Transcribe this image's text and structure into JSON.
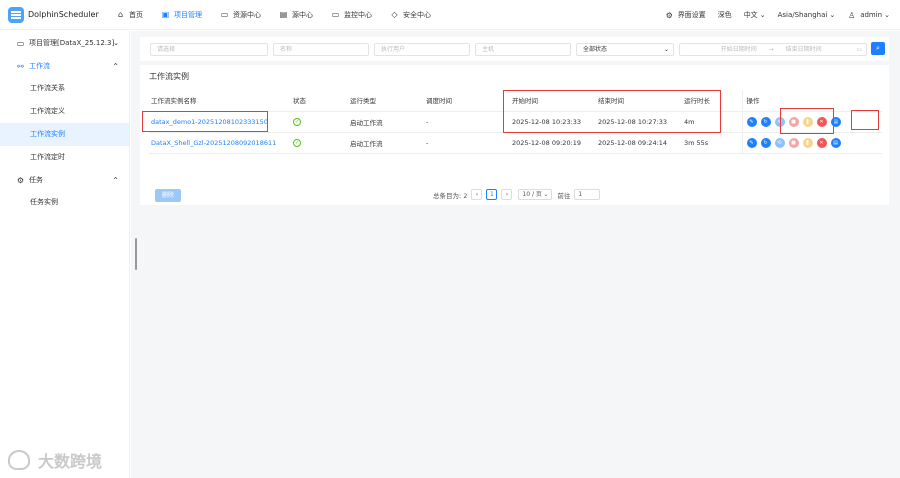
{
  "app": {
    "title": "DolphinScheduler"
  },
  "topnav": [
    {
      "icon": "home-icon",
      "label": "首页"
    },
    {
      "icon": "project-icon",
      "label": "项目管理"
    },
    {
      "icon": "folder-icon",
      "label": "资源中心"
    },
    {
      "icon": "datasource-icon",
      "label": "源中心"
    },
    {
      "icon": "monitor-icon",
      "label": "监控中心"
    },
    {
      "icon": "shield-icon",
      "label": "安全中心"
    }
  ],
  "tools": {
    "ui_settings": "界面设置",
    "theme": "深色",
    "language": "中文",
    "timezone": "Asia/Shanghai",
    "user": "admin"
  },
  "sidebar": {
    "project": "项目管理[DataX_25.12.3]",
    "workflow_group": "工作流",
    "workflow_items": [
      "工作流关系",
      "工作流定义",
      "工作流实例",
      "工作流定时"
    ],
    "task_group": "任务",
    "task_items": [
      "任务实例"
    ]
  },
  "filters": {
    "workflow_def": "请选择",
    "name": "名称",
    "executor": "执行用户",
    "host": "主机",
    "state": "全部状态",
    "start_time": "开始日期时间",
    "arrow": "→",
    "end_time": "结束日期时间"
  },
  "card_title": "工作流实例",
  "table": {
    "headers": [
      "工作流实例名称",
      "状态",
      "运行类型",
      "调度时间",
      "开始时间",
      "结束时间",
      "运行时长",
      "操作"
    ],
    "rows": [
      {
        "name": "datax_demo1-20251208102333150",
        "run_type": "启动工作流",
        "schedule": "-",
        "start": "2025-12-08 10:23:33",
        "end": "2025-12-08 10:27:33",
        "duration": "4m"
      },
      {
        "name": "DataX_Shell_Gzl-20251208092018611",
        "run_type": "启动工作流",
        "schedule": "-",
        "start": "2025-12-08 09:20:19",
        "end": "2025-12-08 09:24:14",
        "duration": "3m 55s"
      }
    ]
  },
  "delete_label": "删除",
  "pagination": {
    "total": "总条目为: 2",
    "prev": "‹",
    "page": "1",
    "next": "›",
    "size": "10 / 页",
    "goto": "前往",
    "goto_value": "1"
  },
  "watermark": "大数跨境",
  "colors": {
    "accent": "#1e80ff",
    "highlight": "#e53b3b",
    "success": "#52c41a"
  }
}
